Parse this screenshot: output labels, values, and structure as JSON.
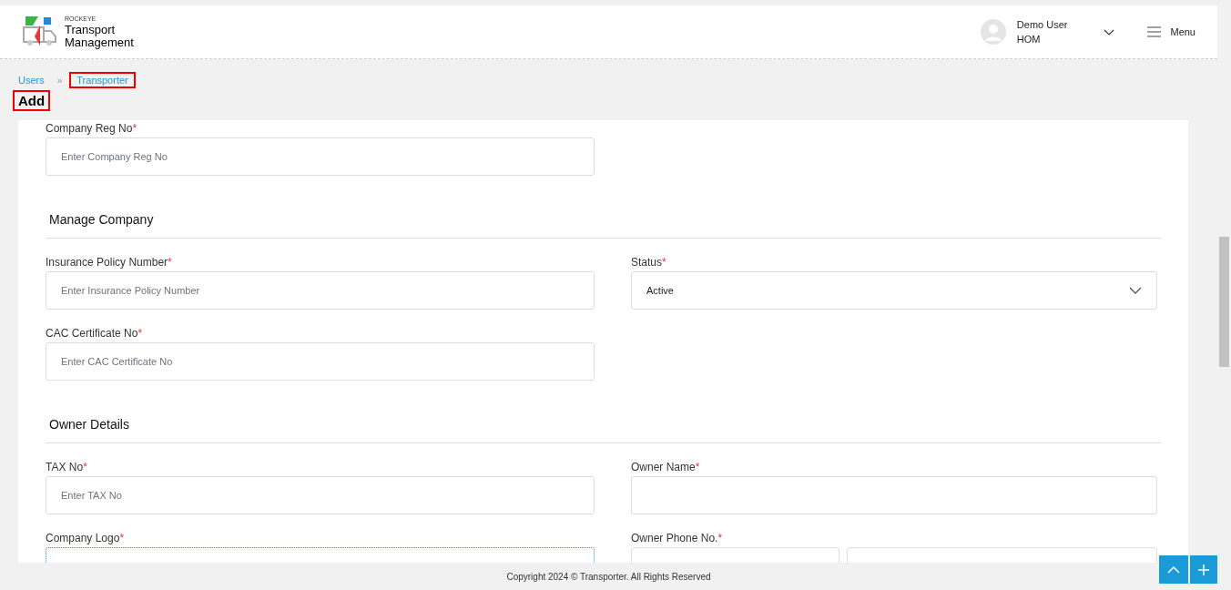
{
  "header": {
    "brand_small": "ROCKEYE",
    "brand_line1": "Transport",
    "brand_line2": "Management",
    "user_name": "Demo User",
    "user_role": "HOM",
    "menu_label": "Menu"
  },
  "breadcrumb": [
    {
      "label": "Users",
      "highlighted": false
    },
    {
      "separator": "»",
      "label": "Transporter",
      "highlighted": true
    }
  ],
  "page_title": "Add",
  "form": [
    {
      "kind": "row",
      "fields": [
        {
          "kind": "text",
          "label": "Company Reg No",
          "required": "*",
          "placeholder": "Enter Company Reg No"
        }
      ]
    },
    {
      "kind": "heading",
      "title": "Manage Company"
    },
    {
      "kind": "row",
      "fields": [
        {
          "kind": "text",
          "label": "Insurance Policy Number",
          "required": "*",
          "placeholder": "Enter Insurance Policy Number"
        },
        {
          "kind": "select",
          "label": "Status",
          "required": "*",
          "value": "Active"
        }
      ]
    },
    {
      "kind": "row",
      "fields": [
        {
          "kind": "text",
          "label": "CAC Certificate No",
          "required": "*",
          "placeholder": "Enter CAC Certificate No"
        }
      ]
    },
    {
      "kind": "heading",
      "title": "Owner Details"
    },
    {
      "kind": "row",
      "fields": [
        {
          "kind": "text",
          "label": "TAX No",
          "required": "*",
          "placeholder": "Enter TAX No"
        },
        {
          "kind": "text",
          "label": "Owner Name",
          "required": "*"
        }
      ]
    },
    {
      "kind": "row",
      "fields": [
        {
          "kind": "upload",
          "label": "Company Logo",
          "required": "*"
        },
        {
          "kind": "phone",
          "label": "Owner Phone No.",
          "required": "*"
        }
      ]
    }
  ],
  "footer": "Copyright 2024 © Transporter. All Rights Reserved"
}
